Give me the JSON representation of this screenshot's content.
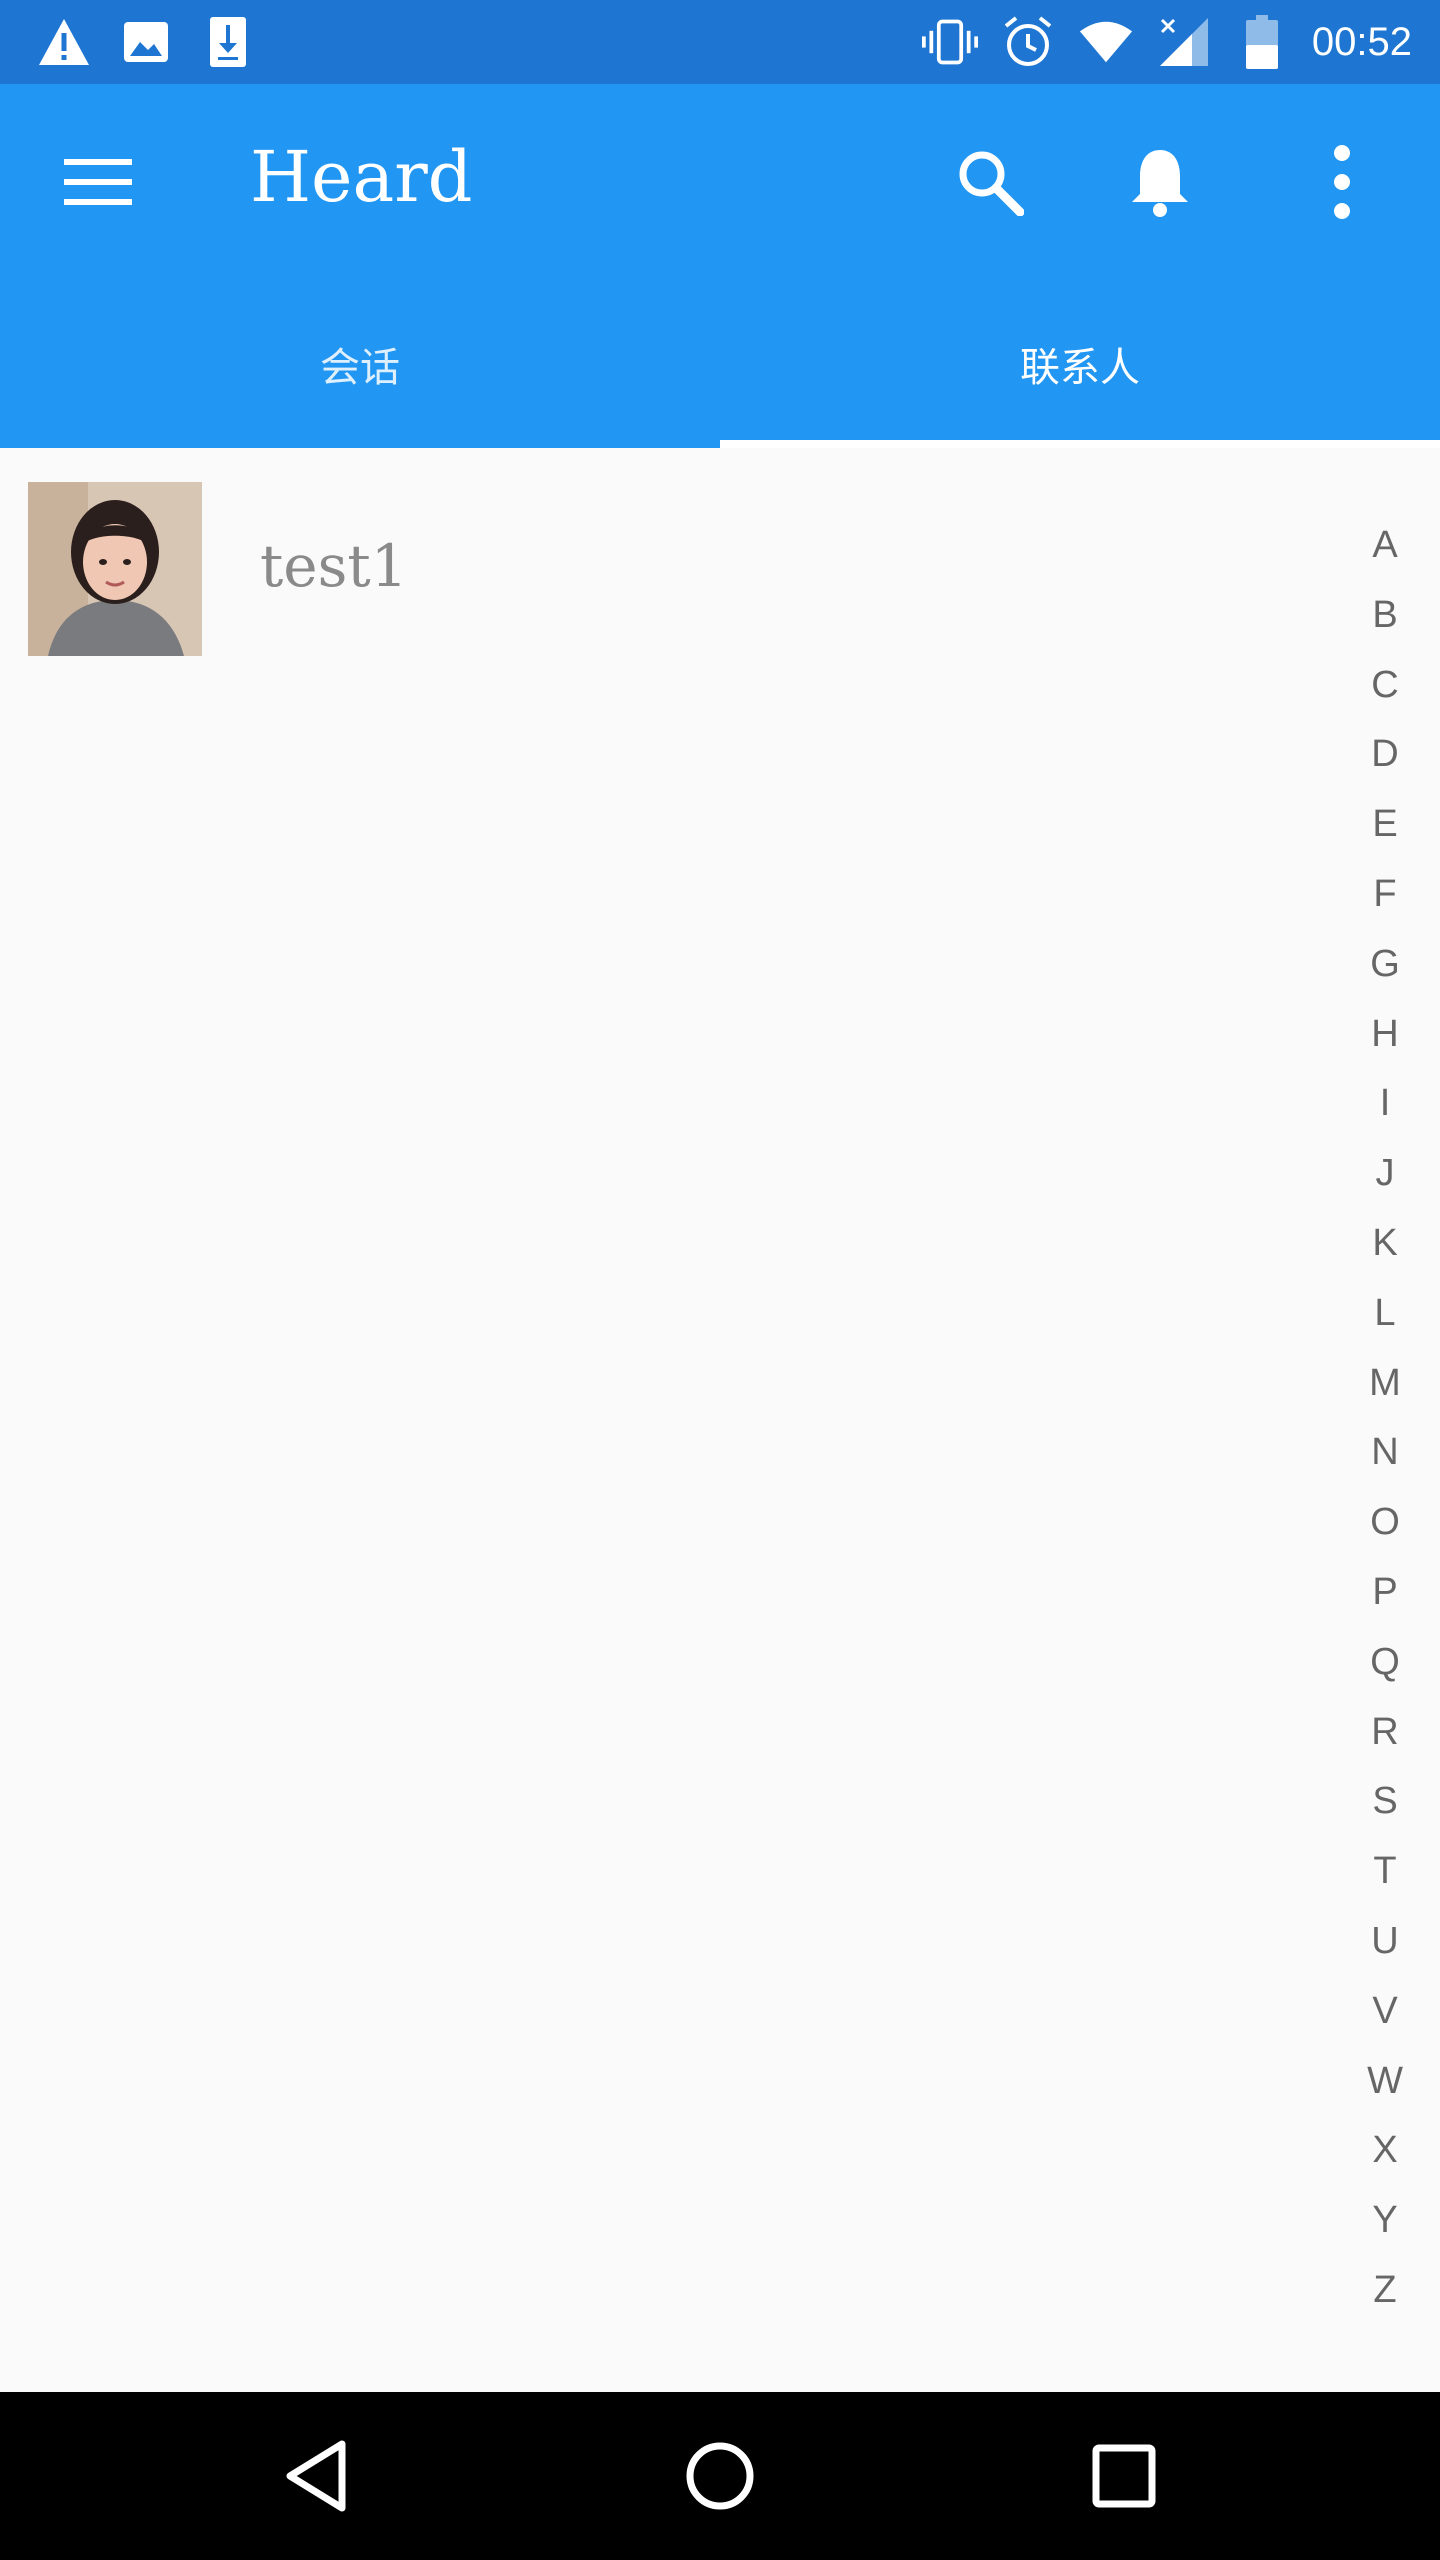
{
  "status_bar": {
    "time": "00:52",
    "left_icons": [
      "warning-icon",
      "image-icon",
      "download-icon"
    ],
    "right_icons": [
      "vibrate-icon",
      "alarm-icon",
      "wifi-icon",
      "signal-icon",
      "battery-icon"
    ]
  },
  "app_bar": {
    "title": "Heard",
    "menu_icon": "menu-icon",
    "search_icon": "search-icon",
    "notification_icon": "bell-icon",
    "overflow_icon": "more-vert-icon"
  },
  "tabs": [
    {
      "label": "会话",
      "active": false
    },
    {
      "label": "联系人",
      "active": true
    }
  ],
  "contacts": [
    {
      "name": "test1",
      "avatar": "avatar-photo"
    }
  ],
  "index_letters": [
    "A",
    "B",
    "C",
    "D",
    "E",
    "F",
    "G",
    "H",
    "I",
    "J",
    "K",
    "L",
    "M",
    "N",
    "O",
    "P",
    "Q",
    "R",
    "S",
    "T",
    "U",
    "V",
    "W",
    "X",
    "Y",
    "Z"
  ],
  "nav_bar": {
    "back_icon": "back-icon",
    "home_icon": "home-icon",
    "recents_icon": "recents-icon"
  },
  "colors": {
    "status_bar": "#1e76d2",
    "primary": "#2196f3",
    "background": "#fafafa",
    "nav_bar": "#000000"
  }
}
